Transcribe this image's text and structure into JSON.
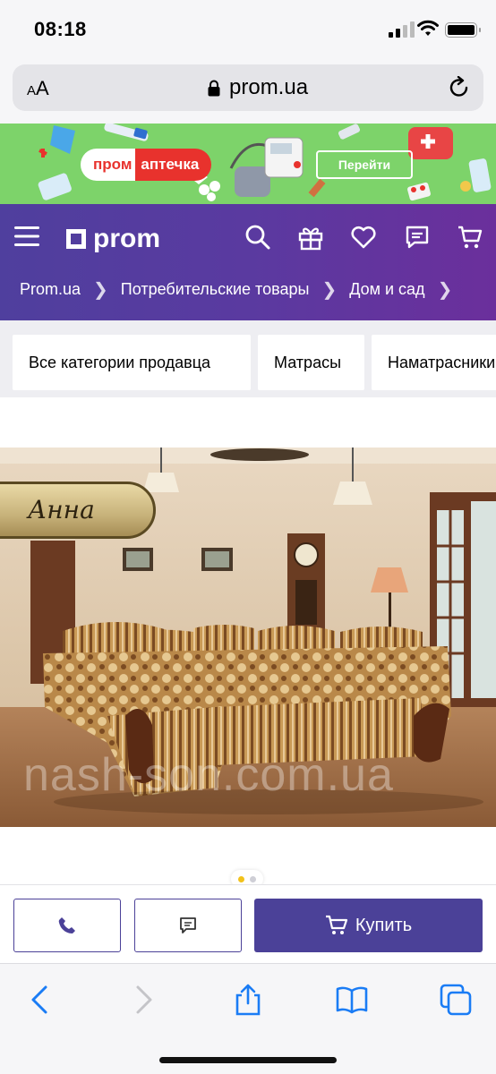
{
  "status_bar": {
    "time": "08:18"
  },
  "browser": {
    "text_size_label_small": "A",
    "text_size_label": "A",
    "domain": "prom.ua"
  },
  "banner": {
    "logo_part1": "пром",
    "logo_part2": "аптечка",
    "button": "Перейти",
    "bg_color": "#7dd36a",
    "accent_color": "#e8322d"
  },
  "header": {
    "logo": "prom",
    "breadcrumbs": [
      "Prom.ua",
      "Потребительские товары",
      "Дом и сад"
    ],
    "gradient": [
      "#4f3f9e",
      "#6b2f9c"
    ]
  },
  "categories": [
    "Все категории продавца",
    "Матрасы",
    "Наматрасники"
  ],
  "product_image": {
    "name_plate": "Анна",
    "watermark": "nash-son.com.ua"
  },
  "gallery": {
    "total": 2,
    "active": 1
  },
  "actions": {
    "buy": "Купить",
    "brand_color": "#4b4198"
  },
  "icons": [
    "menu-icon",
    "search-icon",
    "gift-icon",
    "heart-icon",
    "chat-icon",
    "cart-icon",
    "phone-icon",
    "message-icon",
    "back-icon",
    "forward-icon",
    "share-icon",
    "bookmarks-icon",
    "tabs-icon"
  ]
}
